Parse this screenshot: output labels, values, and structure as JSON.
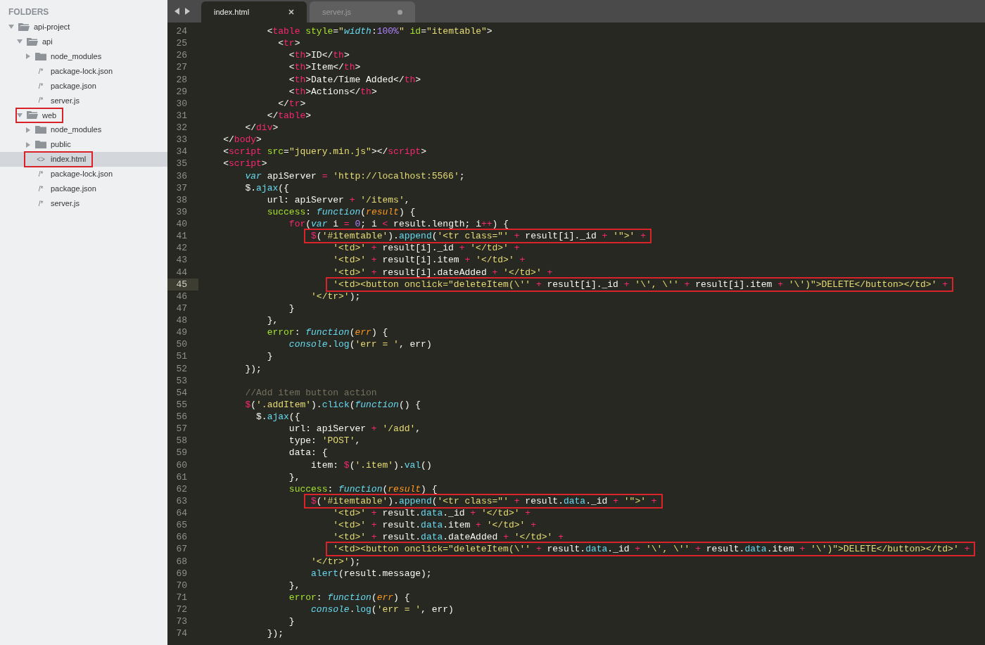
{
  "sidebar": {
    "header": "FOLDERS",
    "tree": [
      {
        "label": "api-project",
        "kind": "folder",
        "expanded": true,
        "boxed": false,
        "selected": false,
        "children": [
          {
            "label": "api",
            "kind": "folder",
            "expanded": true,
            "boxed": false,
            "selected": false,
            "children": [
              {
                "label": "node_modules",
                "kind": "folder",
                "expanded": false,
                "boxed": false,
                "selected": false
              },
              {
                "label": "package-lock.json",
                "kind": "file",
                "glyph": "/*",
                "boxed": false,
                "selected": false
              },
              {
                "label": "package.json",
                "kind": "file",
                "glyph": "/*",
                "boxed": false,
                "selected": false
              },
              {
                "label": "server.js",
                "kind": "file",
                "glyph": "/*",
                "boxed": false,
                "selected": false
              }
            ]
          },
          {
            "label": "web",
            "kind": "folder",
            "expanded": true,
            "boxed": true,
            "selected": false,
            "children": [
              {
                "label": "node_modules",
                "kind": "folder",
                "expanded": false,
                "boxed": false,
                "selected": false
              },
              {
                "label": "public",
                "kind": "folder",
                "expanded": false,
                "boxed": false,
                "selected": false
              },
              {
                "label": "index.html",
                "kind": "file",
                "glyph": "<>",
                "boxed": true,
                "selected": true
              },
              {
                "label": "package-lock.json",
                "kind": "file",
                "glyph": "/*",
                "boxed": false,
                "selected": false
              },
              {
                "label": "package.json",
                "kind": "file",
                "glyph": "/*",
                "boxed": false,
                "selected": false
              },
              {
                "label": "server.js",
                "kind": "file",
                "glyph": "/*",
                "boxed": false,
                "selected": false
              }
            ]
          }
        ]
      }
    ]
  },
  "tabs": [
    {
      "label": "index.html",
      "selected": true,
      "modified": false
    },
    {
      "label": "server.js",
      "selected": false,
      "modified": true
    }
  ],
  "editor": {
    "lines": [
      {
        "number": "24",
        "tokens": [
          {
            "kind": "plain",
            "text": "            <"
          },
          {
            "kind": "tag",
            "text": "table"
          },
          {
            "kind": "attr",
            "text": " style"
          },
          {
            "kind": "plain",
            "text": "="
          },
          {
            "kind": "string",
            "text": "\""
          },
          {
            "kind": "keyword",
            "text": "width"
          },
          {
            "kind": "plain",
            "text": ":"
          },
          {
            "kind": "number",
            "text": "100%"
          },
          {
            "kind": "string",
            "text": "\""
          },
          {
            "kind": "attr",
            "text": " id"
          },
          {
            "kind": "plain",
            "text": "="
          },
          {
            "kind": "string",
            "text": "\"itemtable\""
          },
          {
            "kind": "plain",
            "text": ">"
          }
        ]
      },
      {
        "number": "25",
        "tokens": [
          {
            "kind": "plain",
            "text": "              <"
          },
          {
            "kind": "tag",
            "text": "tr"
          },
          {
            "kind": "plain",
            "text": ">"
          }
        ]
      },
      {
        "number": "26",
        "tokens": [
          {
            "kind": "plain",
            "text": "                <"
          },
          {
            "kind": "tag",
            "text": "th"
          },
          {
            "kind": "plain",
            "text": ">ID</"
          },
          {
            "kind": "tag",
            "text": "th"
          },
          {
            "kind": "plain",
            "text": ">"
          }
        ]
      },
      {
        "number": "27",
        "tokens": [
          {
            "kind": "plain",
            "text": "                <"
          },
          {
            "kind": "tag",
            "text": "th"
          },
          {
            "kind": "plain",
            "text": ">Item</"
          },
          {
            "kind": "tag",
            "text": "th"
          },
          {
            "kind": "plain",
            "text": ">"
          }
        ]
      },
      {
        "number": "28",
        "tokens": [
          {
            "kind": "plain",
            "text": "                <"
          },
          {
            "kind": "tag",
            "text": "th"
          },
          {
            "kind": "plain",
            "text": ">Date/Time Added</"
          },
          {
            "kind": "tag",
            "text": "th"
          },
          {
            "kind": "plain",
            "text": ">"
          }
        ]
      },
      {
        "number": "29",
        "tokens": [
          {
            "kind": "plain",
            "text": "                <"
          },
          {
            "kind": "tag",
            "text": "th"
          },
          {
            "kind": "plain",
            "text": ">Actions</"
          },
          {
            "kind": "tag",
            "text": "th"
          },
          {
            "kind": "plain",
            "text": ">"
          }
        ]
      },
      {
        "number": "30",
        "tokens": [
          {
            "kind": "plain",
            "text": "              </"
          },
          {
            "kind": "tag",
            "text": "tr"
          },
          {
            "kind": "plain",
            "text": ">"
          }
        ]
      },
      {
        "number": "31",
        "tokens": [
          {
            "kind": "plain",
            "text": "            </"
          },
          {
            "kind": "tag",
            "text": "table"
          },
          {
            "kind": "plain",
            "text": ">"
          }
        ]
      },
      {
        "number": "32",
        "tokens": [
          {
            "kind": "plain",
            "text": "        </"
          },
          {
            "kind": "tag",
            "text": "div"
          },
          {
            "kind": "plain",
            "text": ">"
          }
        ]
      },
      {
        "number": "33",
        "tokens": [
          {
            "kind": "plain",
            "text": "    </"
          },
          {
            "kind": "tag",
            "text": "body"
          },
          {
            "kind": "plain",
            "text": ">"
          }
        ]
      },
      {
        "number": "34",
        "tokens": [
          {
            "kind": "plain",
            "text": "    <"
          },
          {
            "kind": "tag",
            "text": "script"
          },
          {
            "kind": "attr",
            "text": " src"
          },
          {
            "kind": "plain",
            "text": "="
          },
          {
            "kind": "string",
            "text": "\"jquery.min.js\""
          },
          {
            "kind": "plain",
            "text": "></"
          },
          {
            "kind": "tag",
            "text": "script"
          },
          {
            "kind": "plain",
            "text": ">"
          }
        ]
      },
      {
        "number": "35",
        "tokens": [
          {
            "kind": "plain",
            "text": "    <"
          },
          {
            "kind": "tag",
            "text": "script"
          },
          {
            "kind": "plain",
            "text": ">"
          }
        ]
      },
      {
        "number": "36",
        "tokens": [
          {
            "kind": "keyword",
            "text": "        var"
          },
          {
            "kind": "plain",
            "text": " apiServer "
          },
          {
            "kind": "operator",
            "text": "="
          },
          {
            "kind": "string",
            "text": " 'http://localhost:5566'"
          },
          {
            "kind": "plain",
            "text": ";"
          }
        ]
      },
      {
        "number": "37",
        "tokens": [
          {
            "kind": "plain",
            "text": "        $."
          },
          {
            "kind": "func",
            "text": "ajax"
          },
          {
            "kind": "plain",
            "text": "({"
          }
        ]
      },
      {
        "number": "38",
        "tokens": [
          {
            "kind": "plain",
            "text": "            url: apiServer "
          },
          {
            "kind": "operator",
            "text": "+"
          },
          {
            "kind": "string",
            "text": " '/items'"
          },
          {
            "kind": "plain",
            "text": ","
          }
        ]
      },
      {
        "number": "39",
        "tokens": [
          {
            "kind": "attr",
            "text": "            success"
          },
          {
            "kind": "plain",
            "text": ": "
          },
          {
            "kind": "keyword",
            "text": "function"
          },
          {
            "kind": "plain",
            "text": "("
          },
          {
            "kind": "param",
            "text": "result"
          },
          {
            "kind": "plain",
            "text": ") {"
          }
        ]
      },
      {
        "number": "40",
        "tokens": [
          {
            "kind": "operator",
            "text": "                for"
          },
          {
            "kind": "plain",
            "text": "("
          },
          {
            "kind": "keyword",
            "text": "var"
          },
          {
            "kind": "plain",
            "text": " i "
          },
          {
            "kind": "operator",
            "text": "="
          },
          {
            "kind": "number",
            "text": " 0"
          },
          {
            "kind": "plain",
            "text": "; i "
          },
          {
            "kind": "operator",
            "text": "<"
          },
          {
            "kind": "plain",
            "text": " result.length; i"
          },
          {
            "kind": "operator",
            "text": "++"
          },
          {
            "kind": "plain",
            "text": ") {"
          }
        ]
      },
      {
        "number": "41",
        "boxed": true,
        "tokens": [
          {
            "kind": "operator",
            "text": "                    $"
          },
          {
            "kind": "plain",
            "text": "("
          },
          {
            "kind": "string",
            "text": "'#itemtable'"
          },
          {
            "kind": "plain",
            "text": ")."
          },
          {
            "kind": "func",
            "text": "append"
          },
          {
            "kind": "plain",
            "text": "("
          },
          {
            "kind": "string",
            "text": "'<tr class=\"'"
          },
          {
            "kind": "operator",
            "text": " +"
          },
          {
            "kind": "plain",
            "text": " result[i]._id "
          },
          {
            "kind": "operator",
            "text": "+"
          },
          {
            "kind": "string",
            "text": " '\">'"
          },
          {
            "kind": "operator",
            "text": " +"
          }
        ]
      },
      {
        "number": "42",
        "tokens": [
          {
            "kind": "string",
            "text": "                        '<td>'"
          },
          {
            "kind": "operator",
            "text": " +"
          },
          {
            "kind": "plain",
            "text": " result[i]._id "
          },
          {
            "kind": "operator",
            "text": "+"
          },
          {
            "kind": "string",
            "text": " '</td>'"
          },
          {
            "kind": "operator",
            "text": " +"
          }
        ]
      },
      {
        "number": "43",
        "tokens": [
          {
            "kind": "string",
            "text": "                        '<td>'"
          },
          {
            "kind": "operator",
            "text": " +"
          },
          {
            "kind": "plain",
            "text": " result[i].item "
          },
          {
            "kind": "operator",
            "text": "+"
          },
          {
            "kind": "string",
            "text": " '</td>'"
          },
          {
            "kind": "operator",
            "text": " +"
          }
        ]
      },
      {
        "number": "44",
        "tokens": [
          {
            "kind": "string",
            "text": "                        '<td>'"
          },
          {
            "kind": "operator",
            "text": " +"
          },
          {
            "kind": "plain",
            "text": " result[i].dateAdded "
          },
          {
            "kind": "operator",
            "text": "+"
          },
          {
            "kind": "string",
            "text": " '</td>'"
          },
          {
            "kind": "operator",
            "text": " +"
          }
        ]
      },
      {
        "number": "45",
        "boxed": true,
        "current": true,
        "tokens": [
          {
            "kind": "string",
            "text": "                        '<td><button onclick=\"deleteItem(\\''"
          },
          {
            "kind": "operator",
            "text": " +"
          },
          {
            "kind": "plain",
            "text": " result[i]._id "
          },
          {
            "kind": "operator",
            "text": "+"
          },
          {
            "kind": "string",
            "text": " '\\', \\''"
          },
          {
            "kind": "operator",
            "text": " +"
          },
          {
            "kind": "plain",
            "text": " result[i].item "
          },
          {
            "kind": "operator",
            "text": "+"
          },
          {
            "kind": "string",
            "text": " '\\')\">DELETE</button></td>'"
          },
          {
            "kind": "operator",
            "text": " +"
          }
        ]
      },
      {
        "number": "46",
        "tokens": [
          {
            "kind": "string",
            "text": "                    '</tr>'"
          },
          {
            "kind": "plain",
            "text": ");"
          }
        ]
      },
      {
        "number": "47",
        "tokens": [
          {
            "kind": "plain",
            "text": "                }"
          }
        ]
      },
      {
        "number": "48",
        "tokens": [
          {
            "kind": "plain",
            "text": "            },"
          }
        ]
      },
      {
        "number": "49",
        "tokens": [
          {
            "kind": "attr",
            "text": "            error"
          },
          {
            "kind": "plain",
            "text": ": "
          },
          {
            "kind": "keyword",
            "text": "function"
          },
          {
            "kind": "plain",
            "text": "("
          },
          {
            "kind": "param",
            "text": "err"
          },
          {
            "kind": "plain",
            "text": ") {"
          }
        ]
      },
      {
        "number": "50",
        "tokens": [
          {
            "kind": "keyword",
            "text": "                console"
          },
          {
            "kind": "plain",
            "text": "."
          },
          {
            "kind": "func",
            "text": "log"
          },
          {
            "kind": "plain",
            "text": "("
          },
          {
            "kind": "string",
            "text": "'err = '"
          },
          {
            "kind": "plain",
            "text": ", err)"
          }
        ]
      },
      {
        "number": "51",
        "tokens": [
          {
            "kind": "plain",
            "text": "            }"
          }
        ]
      },
      {
        "number": "52",
        "tokens": [
          {
            "kind": "plain",
            "text": "        });"
          }
        ]
      },
      {
        "number": "53"
      },
      {
        "number": "54",
        "tokens": [
          {
            "kind": "comment",
            "text": "        //Add item button action"
          }
        ]
      },
      {
        "number": "55",
        "tokens": [
          {
            "kind": "operator",
            "text": "        $"
          },
          {
            "kind": "plain",
            "text": "("
          },
          {
            "kind": "string",
            "text": "'.addItem'"
          },
          {
            "kind": "plain",
            "text": ")."
          },
          {
            "kind": "func",
            "text": "click"
          },
          {
            "kind": "plain",
            "text": "("
          },
          {
            "kind": "keyword",
            "text": "function"
          },
          {
            "kind": "plain",
            "text": "() {"
          }
        ]
      },
      {
        "number": "56",
        "tokens": [
          {
            "kind": "plain",
            "text": "          $."
          },
          {
            "kind": "func",
            "text": "ajax"
          },
          {
            "kind": "plain",
            "text": "({"
          }
        ]
      },
      {
        "number": "57",
        "tokens": [
          {
            "kind": "plain",
            "text": "                url: apiServer "
          },
          {
            "kind": "operator",
            "text": "+"
          },
          {
            "kind": "string",
            "text": " '/add'"
          },
          {
            "kind": "plain",
            "text": ","
          }
        ]
      },
      {
        "number": "58",
        "tokens": [
          {
            "kind": "plain",
            "text": "                type: "
          },
          {
            "kind": "string",
            "text": "'POST'"
          },
          {
            "kind": "plain",
            "text": ","
          }
        ]
      },
      {
        "number": "59",
        "tokens": [
          {
            "kind": "plain",
            "text": "                data: {"
          }
        ]
      },
      {
        "number": "60",
        "tokens": [
          {
            "kind": "plain",
            "text": "                    item: "
          },
          {
            "kind": "operator",
            "text": "$"
          },
          {
            "kind": "plain",
            "text": "("
          },
          {
            "kind": "string",
            "text": "'.item'"
          },
          {
            "kind": "plain",
            "text": ")."
          },
          {
            "kind": "func",
            "text": "val"
          },
          {
            "kind": "plain",
            "text": "()"
          }
        ]
      },
      {
        "number": "61",
        "tokens": [
          {
            "kind": "plain",
            "text": "                },"
          }
        ]
      },
      {
        "number": "62",
        "tokens": [
          {
            "kind": "attr",
            "text": "                success"
          },
          {
            "kind": "plain",
            "text": ": "
          },
          {
            "kind": "keyword",
            "text": "function"
          },
          {
            "kind": "plain",
            "text": "("
          },
          {
            "kind": "param",
            "text": "result"
          },
          {
            "kind": "plain",
            "text": ") {"
          }
        ]
      },
      {
        "number": "63",
        "boxed": true,
        "tokens": [
          {
            "kind": "operator",
            "text": "                    $"
          },
          {
            "kind": "plain",
            "text": "("
          },
          {
            "kind": "string",
            "text": "'#itemtable'"
          },
          {
            "kind": "plain",
            "text": ")."
          },
          {
            "kind": "func",
            "text": "append"
          },
          {
            "kind": "plain",
            "text": "("
          },
          {
            "kind": "string",
            "text": "'<tr class=\"'"
          },
          {
            "kind": "operator",
            "text": " +"
          },
          {
            "kind": "plain",
            "text": " result."
          },
          {
            "kind": "func",
            "text": "data"
          },
          {
            "kind": "plain",
            "text": "._id "
          },
          {
            "kind": "operator",
            "text": "+"
          },
          {
            "kind": "string",
            "text": " '\">'"
          },
          {
            "kind": "operator",
            "text": " +"
          }
        ]
      },
      {
        "number": "64",
        "tokens": [
          {
            "kind": "string",
            "text": "                        '<td>'"
          },
          {
            "kind": "operator",
            "text": " +"
          },
          {
            "kind": "plain",
            "text": " result."
          },
          {
            "kind": "func",
            "text": "data"
          },
          {
            "kind": "plain",
            "text": "._id "
          },
          {
            "kind": "operator",
            "text": "+"
          },
          {
            "kind": "string",
            "text": " '</td>'"
          },
          {
            "kind": "operator",
            "text": " +"
          }
        ]
      },
      {
        "number": "65",
        "tokens": [
          {
            "kind": "string",
            "text": "                        '<td>'"
          },
          {
            "kind": "operator",
            "text": " +"
          },
          {
            "kind": "plain",
            "text": " result."
          },
          {
            "kind": "func",
            "text": "data"
          },
          {
            "kind": "plain",
            "text": ".item "
          },
          {
            "kind": "operator",
            "text": "+"
          },
          {
            "kind": "string",
            "text": " '</td>'"
          },
          {
            "kind": "operator",
            "text": " +"
          }
        ]
      },
      {
        "number": "66",
        "tokens": [
          {
            "kind": "string",
            "text": "                        '<td>'"
          },
          {
            "kind": "operator",
            "text": " +"
          },
          {
            "kind": "plain",
            "text": " result."
          },
          {
            "kind": "func",
            "text": "data"
          },
          {
            "kind": "plain",
            "text": ".dateAdded "
          },
          {
            "kind": "operator",
            "text": "+"
          },
          {
            "kind": "string",
            "text": " '</td>'"
          },
          {
            "kind": "operator",
            "text": " +"
          }
        ]
      },
      {
        "number": "67",
        "boxed": true,
        "tokens": [
          {
            "kind": "string",
            "text": "                        '<td><button onclick=\"deleteItem(\\''"
          },
          {
            "kind": "operator",
            "text": " +"
          },
          {
            "kind": "plain",
            "text": " result."
          },
          {
            "kind": "func",
            "text": "data"
          },
          {
            "kind": "plain",
            "text": "._id "
          },
          {
            "kind": "operator",
            "text": "+"
          },
          {
            "kind": "string",
            "text": " '\\', \\''"
          },
          {
            "kind": "operator",
            "text": " +"
          },
          {
            "kind": "plain",
            "text": " result."
          },
          {
            "kind": "func",
            "text": "data"
          },
          {
            "kind": "plain",
            "text": ".item "
          },
          {
            "kind": "operator",
            "text": "+"
          },
          {
            "kind": "string",
            "text": " '\\')\">DELETE</button></td>'"
          },
          {
            "kind": "operator",
            "text": " +"
          }
        ]
      },
      {
        "number": "68",
        "tokens": [
          {
            "kind": "string",
            "text": "                    '</tr>'"
          },
          {
            "kind": "plain",
            "text": ");"
          }
        ]
      },
      {
        "number": "69",
        "tokens": [
          {
            "kind": "func",
            "text": "                    alert"
          },
          {
            "kind": "plain",
            "text": "(result.message);"
          }
        ]
      },
      {
        "number": "70",
        "tokens": [
          {
            "kind": "plain",
            "text": "                },"
          }
        ]
      },
      {
        "number": "71",
        "tokens": [
          {
            "kind": "attr",
            "text": "                error"
          },
          {
            "kind": "plain",
            "text": ": "
          },
          {
            "kind": "keyword",
            "text": "function"
          },
          {
            "kind": "plain",
            "text": "("
          },
          {
            "kind": "param",
            "text": "err"
          },
          {
            "kind": "plain",
            "text": ") {"
          }
        ]
      },
      {
        "number": "72",
        "tokens": [
          {
            "kind": "keyword",
            "text": "                    console"
          },
          {
            "kind": "plain",
            "text": "."
          },
          {
            "kind": "func",
            "text": "log"
          },
          {
            "kind": "plain",
            "text": "("
          },
          {
            "kind": "string",
            "text": "'err = '"
          },
          {
            "kind": "plain",
            "text": ", err)"
          }
        ]
      },
      {
        "number": "73",
        "tokens": [
          {
            "kind": "plain",
            "text": "                }"
          }
        ]
      },
      {
        "number": "74",
        "tokens": [
          {
            "kind": "plain",
            "text": "            });"
          }
        ]
      }
    ]
  }
}
